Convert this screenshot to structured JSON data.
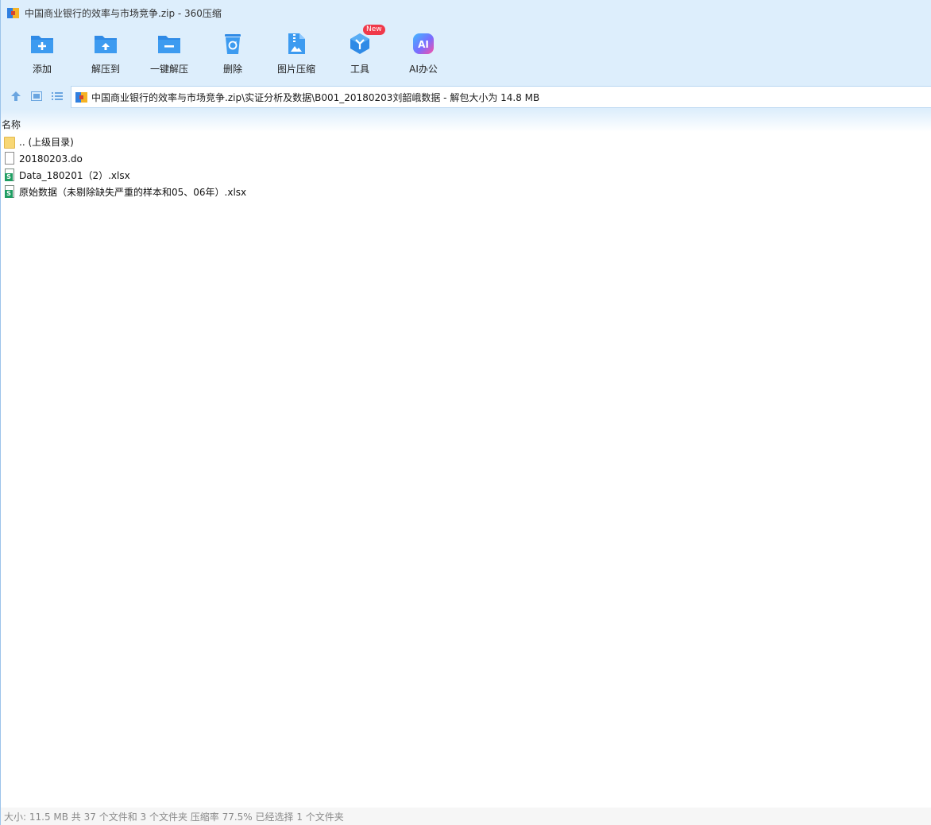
{
  "window": {
    "title": "中国商业银行的效率与市场竞争.zip - 360压缩"
  },
  "toolbar": {
    "items": [
      {
        "label": "添加",
        "icon": "folder-add-icon"
      },
      {
        "label": "解压到",
        "icon": "folder-extract-icon"
      },
      {
        "label": "一键解压",
        "icon": "folder-one-click-extract-icon"
      },
      {
        "label": "删除",
        "icon": "recycle-bin-icon"
      },
      {
        "label": "图片压缩",
        "icon": "image-compress-icon"
      },
      {
        "label": "工具",
        "icon": "tools-cube-icon",
        "badge": "New"
      },
      {
        "label": "AI办公",
        "icon": "ai-office-icon"
      }
    ]
  },
  "address": {
    "path": "中国商业银行的效率与市场竞争.zip\\实证分析及数据\\B001_20180203刘韶峨数据 - 解包大小为 14.8 MB"
  },
  "list": {
    "column_name": "名称",
    "files": [
      {
        "name": ".. (上级目录)",
        "type": "folder"
      },
      {
        "name": "20180203.do",
        "type": "file"
      },
      {
        "name": "Data_180201（2）.xlsx",
        "type": "xlsx"
      },
      {
        "name": "原始数据（未剔除缺失严重的样本和05、06年）.xlsx",
        "type": "xlsx"
      }
    ]
  },
  "status": {
    "text": "大小: 11.5 MB 共 37 个文件和 3 个文件夹 压缩率 77.5% 已经选择 1 个文件夹"
  },
  "colors": {
    "toolbar_bg": "#ddeefc",
    "accent_blue": "#2f8ae6",
    "badge_red": "#f0394a",
    "xlsx_green": "#1f9d62"
  }
}
